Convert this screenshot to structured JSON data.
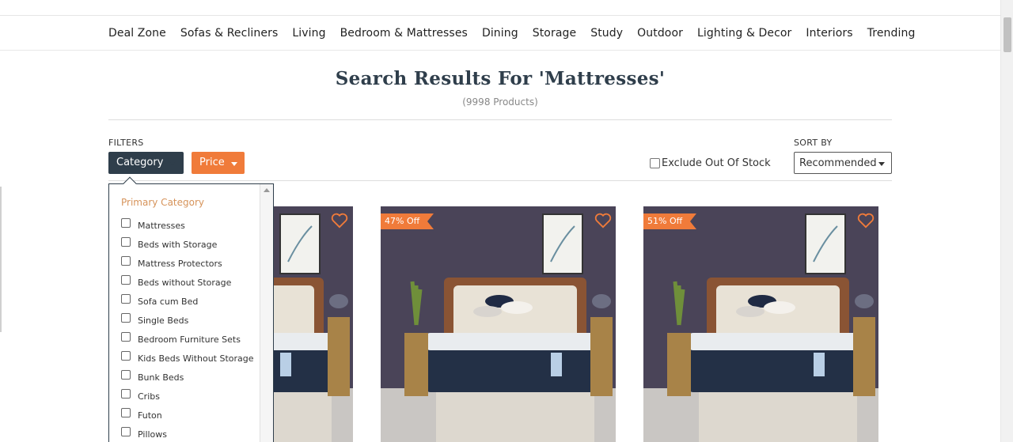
{
  "nav": {
    "items": [
      "Deal Zone",
      "Sofas & Recliners",
      "Living",
      "Bedroom & Mattresses",
      "Dining",
      "Storage",
      "Study",
      "Outdoor",
      "Lighting & Decor",
      "Interiors",
      "Trending"
    ]
  },
  "search": {
    "title": "Search Results For 'Mattresses'",
    "count": "(9998 Products)"
  },
  "filters": {
    "label": "FILTERS",
    "category_label": "Category",
    "price_label": "Price",
    "exclude_label": "Exclude Out Of Stock"
  },
  "sort": {
    "label": "SORT BY",
    "selected": "Recommended"
  },
  "category_dropdown": {
    "heading": "Primary Category",
    "options": [
      "Mattresses",
      "Beds with Storage",
      "Mattress Protectors",
      "Beds without Storage",
      "Sofa cum Bed",
      "Single Beds",
      "Bedroom Furniture Sets",
      "Kids Beds Without Storage",
      "Bunk Beds",
      "Cribs",
      "Futon",
      "Pillows"
    ]
  },
  "products": [
    {
      "badge": ""
    },
    {
      "badge": "47% Off"
    },
    {
      "badge": "51% Off"
    }
  ],
  "colors": {
    "primary_dark": "#2f3e4b",
    "accent_orange": "#f07b3a",
    "heading_orange": "#d6935a"
  }
}
